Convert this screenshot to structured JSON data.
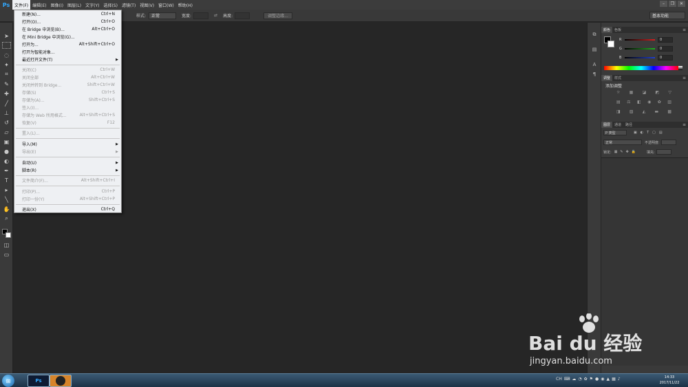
{
  "app": {
    "logo": "Ps"
  },
  "menubar": {
    "items": [
      {
        "label": "文件(F)",
        "active": true
      },
      {
        "label": "编辑(E)"
      },
      {
        "label": "图像(I)"
      },
      {
        "label": "图层(L)"
      },
      {
        "label": "文字(Y)"
      },
      {
        "label": "选择(S)"
      },
      {
        "label": "滤镜(T)"
      },
      {
        "label": "视图(V)"
      },
      {
        "label": "窗口(W)"
      },
      {
        "label": "帮助(H)"
      }
    ],
    "window_buttons": [
      "–",
      "❐",
      "✕"
    ]
  },
  "options_bar": {
    "style_label": "样式:",
    "style_value": "正常",
    "width_label": "宽度:",
    "height_label": "高度:",
    "refine_edge": "调整边缘...",
    "workspace": "基本功能"
  },
  "file_menu": {
    "items": [
      {
        "label": "新建(N)...",
        "shortcut": "Ctrl+N",
        "enabled": true
      },
      {
        "label": "打开(O)...",
        "shortcut": "Ctrl+O",
        "enabled": true
      },
      {
        "label": "在 Bridge 中浏览(B)...",
        "shortcut": "Alt+Ctrl+O",
        "enabled": true
      },
      {
        "label": "在 Mini Bridge 中浏览(G)...",
        "shortcut": "",
        "enabled": true
      },
      {
        "label": "打开为...",
        "shortcut": "Alt+Shift+Ctrl+O",
        "enabled": true
      },
      {
        "label": "打开为智能对象...",
        "shortcut": "",
        "enabled": true
      },
      {
        "label": "最近打开文件(T)",
        "shortcut": "",
        "enabled": true,
        "submenu": true
      },
      {
        "label": "关闭(C)",
        "shortcut": "Ctrl+W",
        "enabled": false
      },
      {
        "label": "关闭全部",
        "shortcut": "Alt+Ctrl+W",
        "enabled": false
      },
      {
        "label": "关闭并转到 Bridge...",
        "shortcut": "Shift+Ctrl+W",
        "enabled": false
      },
      {
        "label": "存储(S)",
        "shortcut": "Ctrl+S",
        "enabled": false
      },
      {
        "label": "存储为(A)...",
        "shortcut": "Shift+Ctrl+S",
        "enabled": false
      },
      {
        "label": "签入(I)...",
        "shortcut": "",
        "enabled": false
      },
      {
        "label": "存储为 Web 所用格式...",
        "shortcut": "Alt+Shift+Ctrl+S",
        "enabled": false
      },
      {
        "label": "恢复(V)",
        "shortcut": "F12",
        "enabled": false
      },
      {
        "label": "置入(L)...",
        "shortcut": "",
        "enabled": false
      },
      {
        "label": "导入(M)",
        "shortcut": "",
        "enabled": true,
        "submenu": true
      },
      {
        "label": "导出(E)",
        "shortcut": "",
        "enabled": false,
        "submenu": true
      },
      {
        "label": "自动(U)",
        "shortcut": "",
        "enabled": true,
        "submenu": true
      },
      {
        "label": "脚本(R)",
        "shortcut": "",
        "enabled": true,
        "submenu": true
      },
      {
        "label": "文件简介(F)...",
        "shortcut": "Alt+Shift+Ctrl+I",
        "enabled": false
      },
      {
        "label": "打印(P)...",
        "shortcut": "Ctrl+P",
        "enabled": false
      },
      {
        "label": "打印一份(Y)",
        "shortcut": "Alt+Shift+Ctrl+P",
        "enabled": false
      },
      {
        "label": "退出(X)",
        "shortcut": "Ctrl+Q",
        "enabled": true
      }
    ]
  },
  "color_panel": {
    "tabs": [
      "颜色",
      "色板"
    ],
    "channels": [
      {
        "letter": "R",
        "value": "0",
        "color": "#d42020"
      },
      {
        "letter": "G",
        "value": "0",
        "color": "#20b020"
      },
      {
        "letter": "B",
        "value": "0",
        "color": "#2040d0"
      }
    ]
  },
  "adjustments_panel": {
    "tabs": [
      "调整",
      "样式"
    ],
    "title": "添加调整"
  },
  "layers_panel": {
    "tabs": [
      "图层",
      "通道",
      "路径"
    ],
    "kind_filter": "P 类型",
    "blend_mode": "正常",
    "opacity_label": "不透明度:",
    "lock_label": "锁定:",
    "fill_label": "填充:"
  },
  "taskbar": {
    "apps": [
      "Ps",
      ""
    ],
    "ime": "CH",
    "time": "14:33",
    "date": "2017/11/22"
  },
  "watermark": {
    "brand": "Bai du 经验",
    "url": "jingyan.baidu.com"
  }
}
